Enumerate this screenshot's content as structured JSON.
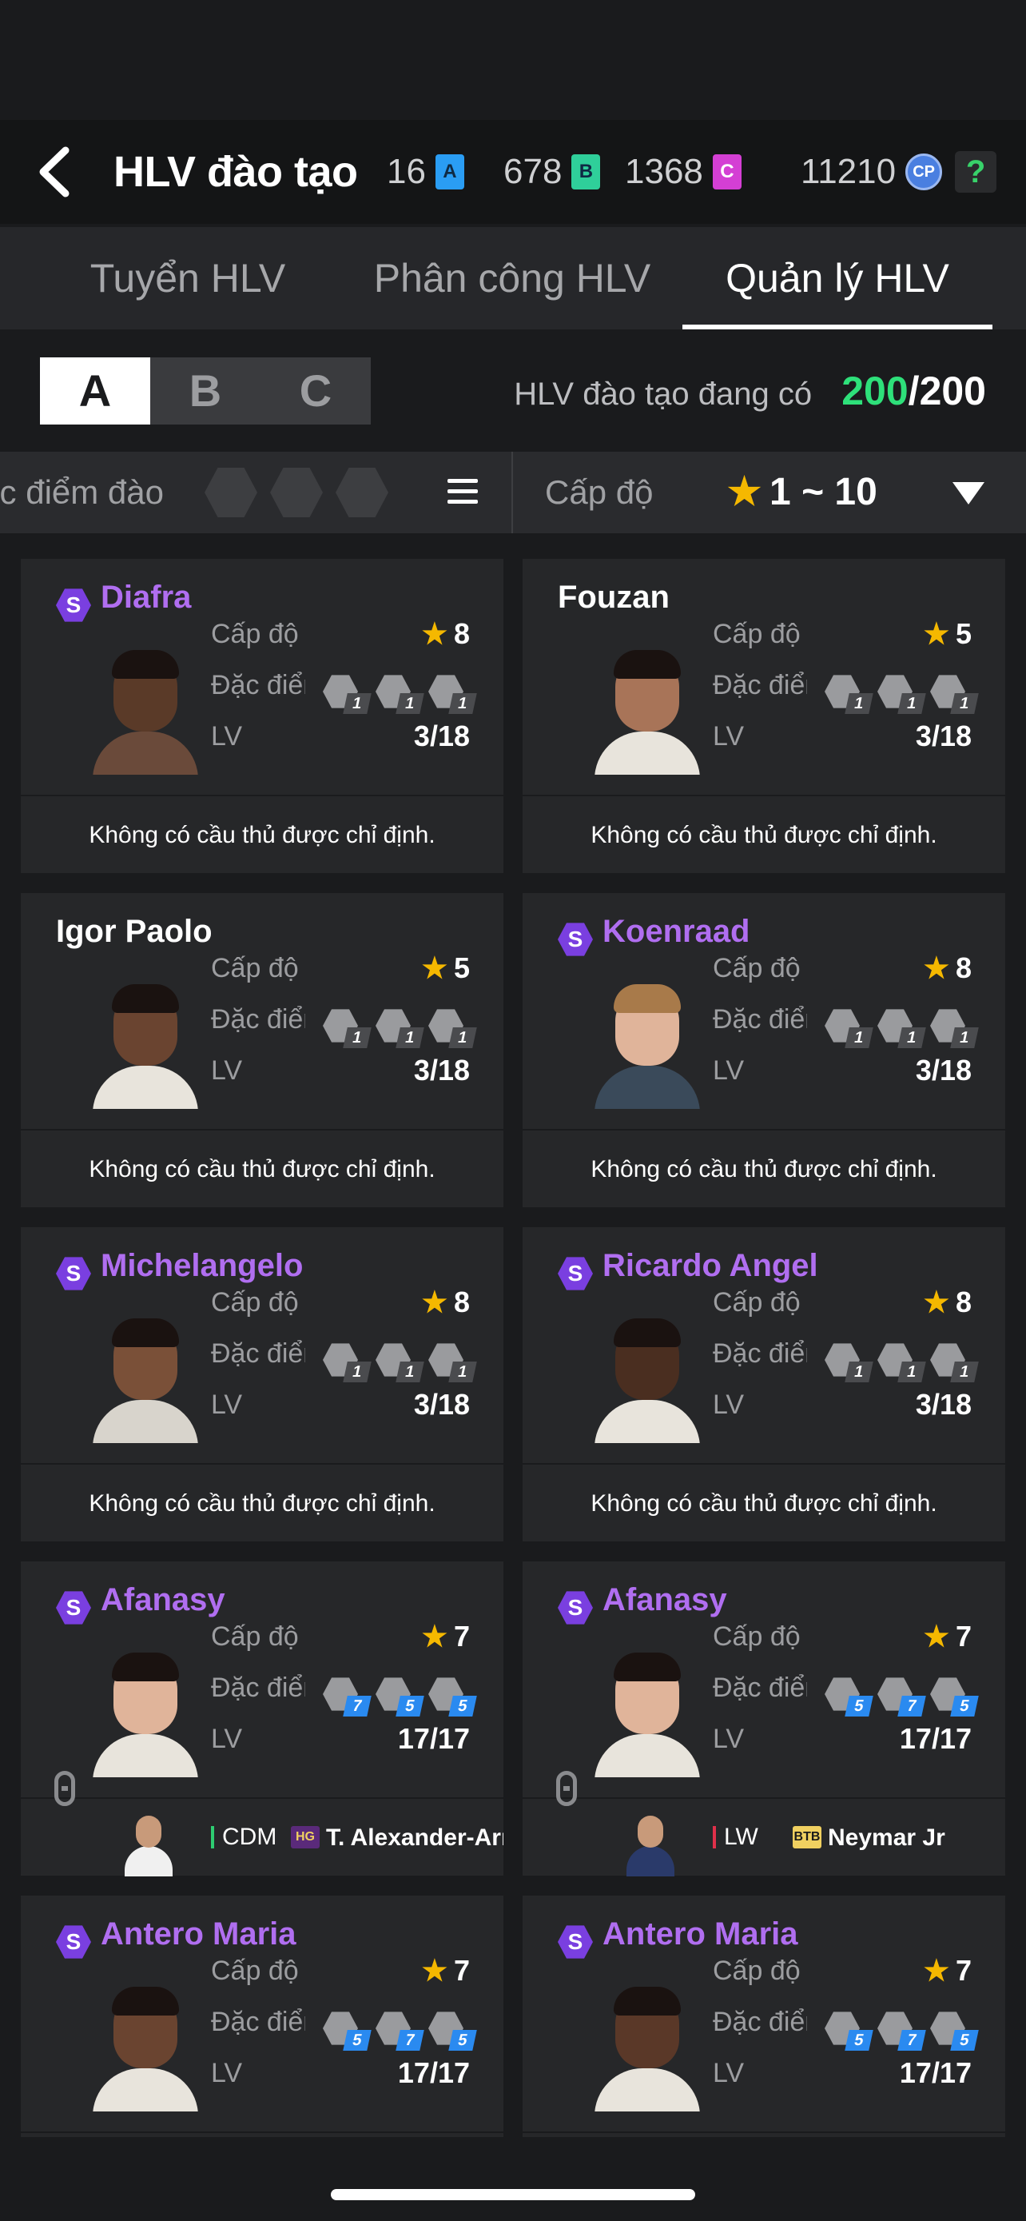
{
  "header": {
    "title": "HLV đào tạo",
    "currencies": [
      {
        "value": "16",
        "badge": "A",
        "color": "#2a9df4"
      },
      {
        "value": "678",
        "badge": "B",
        "color": "#2fcf9a"
      },
      {
        "value": "1368",
        "badge": "C",
        "color": "#d43fd4"
      },
      {
        "value": "11210",
        "badge": "CP",
        "color": "#4a7fe0"
      }
    ],
    "help": "?"
  },
  "tabs": [
    {
      "label": "Tuyển HLV",
      "active": false
    },
    {
      "label": "Phân công HLV",
      "active": false
    },
    {
      "label": "Quản lý HLV",
      "active": true
    }
  ],
  "groups": [
    {
      "label": "A",
      "active": true
    },
    {
      "label": "B",
      "active": false
    },
    {
      "label": "C",
      "active": false
    }
  ],
  "stock": {
    "label": "HLV đào tạo đang có",
    "current": "200",
    "max": "/200"
  },
  "filter": {
    "trait_label": "Đặc điểm đào",
    "level_label": "Cấp độ",
    "level_range": "1 ~ 10"
  },
  "labels": {
    "level": "Cấp độ",
    "trait": "Đặc điểm",
    "lv": "LV",
    "no_player": "Không có cầu thủ được chỉ định."
  },
  "coaches": [
    {
      "name": "Diafra",
      "special": true,
      "stars": "8",
      "lv": "3/18",
      "traits": [
        "1",
        "1",
        "1"
      ],
      "assigned": null,
      "skin": "#5a3a28",
      "hair": "#1a1210",
      "shirt": "#6a4a3a"
    },
    {
      "name": "Fouzan",
      "special": false,
      "stars": "5",
      "lv": "3/18",
      "traits": [
        "1",
        "1",
        "1"
      ],
      "assigned": null,
      "skin": "#a87458",
      "hair": "#1a1210",
      "shirt": "#e8e4dc"
    },
    {
      "name": "Igor Paolo",
      "special": false,
      "stars": "5",
      "lv": "3/18",
      "traits": [
        "1",
        "1",
        "1"
      ],
      "assigned": null,
      "skin": "#6a4430",
      "hair": "#1a1210",
      "shirt": "#e8e4dc"
    },
    {
      "name": "Koenraad",
      "special": true,
      "stars": "8",
      "lv": "3/18",
      "traits": [
        "1",
        "1",
        "1"
      ],
      "assigned": null,
      "skin": "#e0b49a",
      "hair": "#a87a4a",
      "shirt": "#3a4a5a"
    },
    {
      "name": "Michelangelo",
      "special": true,
      "stars": "8",
      "lv": "3/18",
      "traits": [
        "1",
        "1",
        "1"
      ],
      "assigned": null,
      "skin": "#7a5038",
      "hair": "#1a1210",
      "shirt": "#d8d4cc"
    },
    {
      "name": "Ricardo Angel",
      "special": true,
      "stars": "8",
      "lv": "3/18",
      "traits": [
        "1",
        "1",
        "1"
      ],
      "assigned": null,
      "skin": "#4a2e20",
      "hair": "#1a1210",
      "shirt": "#e8e4dc"
    },
    {
      "name": "Afanasy",
      "special": true,
      "stars": "7",
      "lv": "17/17",
      "traits": [
        "7",
        "5",
        "5"
      ],
      "assigned": {
        "pos": "CDM",
        "pos_color": "green",
        "team": "HG",
        "team_bg": "#5a2a7a",
        "team_fg": "#f0d060",
        "player": "T. Alexander-Arnol",
        "shirt": "#f0f0f0"
      },
      "skin": "#e0b49a",
      "hair": "#1a1210",
      "shirt": "#e8e4dc"
    },
    {
      "name": "Afanasy",
      "special": true,
      "stars": "7",
      "lv": "17/17",
      "traits": [
        "5",
        "7",
        "5"
      ],
      "assigned": {
        "pos": "LW",
        "pos_color": "red",
        "team": "BTB",
        "team_bg": "#f0d060",
        "team_fg": "#1a1a1a",
        "player": "Neymar Jr",
        "shirt": "#2a3a6a"
      },
      "skin": "#e0b49a",
      "hair": "#1a1210",
      "shirt": "#e8e4dc"
    },
    {
      "name": "Antero Maria",
      "special": true,
      "stars": "7",
      "lv": "17/17",
      "traits": [
        "5",
        "7",
        "5"
      ],
      "assigned": null,
      "skin": "#6a4430",
      "hair": "#1a1210",
      "shirt": "#e8e4dc"
    },
    {
      "name": "Antero Maria",
      "special": true,
      "stars": "7",
      "lv": "17/17",
      "traits": [
        "5",
        "7",
        "5"
      ],
      "assigned": null,
      "skin": "#5a3828",
      "hair": "#1a1210",
      "shirt": "#e8e4dc"
    }
  ]
}
